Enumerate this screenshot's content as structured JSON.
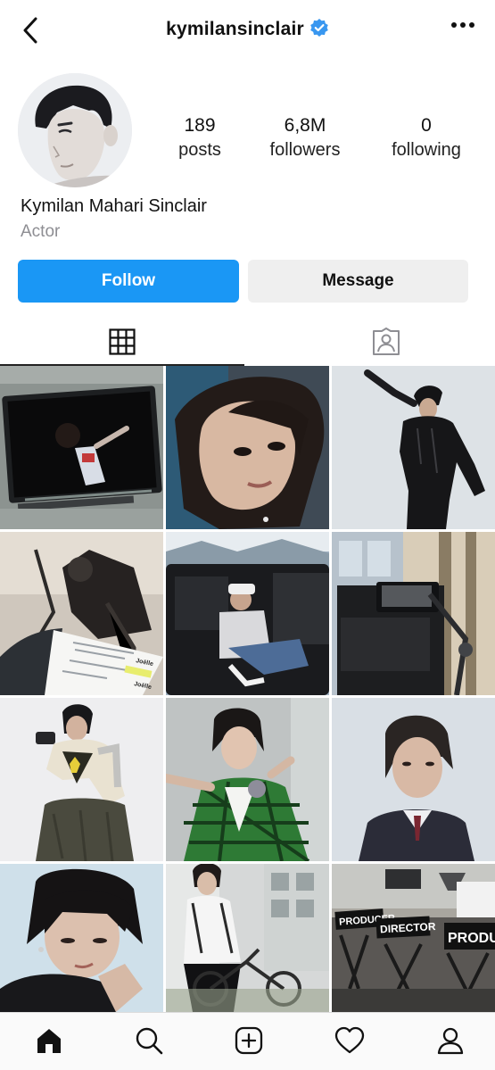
{
  "header": {
    "username": "kymilansinclair",
    "verified": true,
    "back_icon": "chevron-left-icon",
    "more_icon": "more-horizontal-icon"
  },
  "profile": {
    "full_name": "Kymilan Mahari Sinclair",
    "category": "Actor",
    "stats": {
      "posts_count": "189",
      "posts_label": "posts",
      "followers_count": "6,8M",
      "followers_label": "followers",
      "following_count": "0",
      "following_label": "following"
    }
  },
  "actions": {
    "follow_label": "Follow",
    "message_label": "Message"
  },
  "tabs": [
    {
      "name": "posts-grid",
      "icon": "grid-icon",
      "active": true
    },
    {
      "name": "tagged",
      "icon": "tagged-person-icon",
      "active": false
    }
  ],
  "posts": [
    {
      "id": 1,
      "caption": ""
    },
    {
      "id": 2,
      "caption": ""
    },
    {
      "id": 3,
      "caption": ""
    },
    {
      "id": 4,
      "caption": ""
    },
    {
      "id": 5,
      "caption": ""
    },
    {
      "id": 6,
      "caption": ""
    },
    {
      "id": 7,
      "caption": ""
    },
    {
      "id": 8,
      "caption": ""
    },
    {
      "id": 9,
      "caption": ""
    },
    {
      "id": 10,
      "caption": ""
    },
    {
      "id": 11,
      "caption": ""
    },
    {
      "id": 12,
      "caption": ""
    }
  ],
  "post_text": {
    "script_scene_1": "Joëlle",
    "script_scene_2": "Joëlle",
    "chair_1": "PRODUCER",
    "chair_2": "DIRECTOR",
    "chair_3": "PRODUC"
  },
  "bottom_nav": [
    {
      "name": "home",
      "icon": "home-icon",
      "active": true
    },
    {
      "name": "search",
      "icon": "search-icon",
      "active": false
    },
    {
      "name": "create",
      "icon": "add-post-icon",
      "active": false
    },
    {
      "name": "activity",
      "icon": "heart-icon",
      "active": false
    },
    {
      "name": "profile",
      "icon": "profile-icon",
      "active": false
    }
  ],
  "colors": {
    "accent": "#1a97f5",
    "verified": "#3897f0",
    "muted": "#8e8e93",
    "secondary_button": "#efefef"
  }
}
